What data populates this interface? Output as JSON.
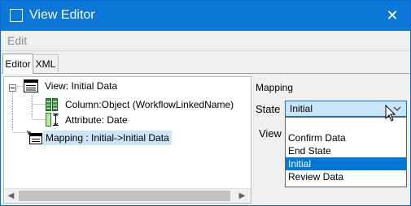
{
  "window": {
    "title": "View Editor",
    "close_glyph": "✕"
  },
  "menu": {
    "edit": "Edit"
  },
  "tabs": [
    {
      "label": "Editor",
      "active": true
    },
    {
      "label": "XML",
      "active": false
    }
  ],
  "tree": {
    "root": {
      "label": "View: Initial Data",
      "icon": "table-icon",
      "expanded": true
    },
    "children": [
      {
        "label": "Column:Object (WorkflowLinkedName)",
        "icon": "column-icon"
      },
      {
        "label": "Attribute: Date",
        "icon": "attribute-icon"
      }
    ],
    "mapping": {
      "label": "Mapping : Initial->Initial Data",
      "icon": "mapping-icon",
      "selected": true
    }
  },
  "mapping_panel": {
    "title": "Mapping",
    "state_label": "State",
    "view_label": "View",
    "state_value": "Initial",
    "options": [
      {
        "label": "",
        "selected": false
      },
      {
        "label": "Confirm Data",
        "selected": false
      },
      {
        "label": "End State",
        "selected": false
      },
      {
        "label": "Initial",
        "selected": true
      },
      {
        "label": "Review Data",
        "selected": false
      }
    ]
  },
  "scrollbar": {
    "left_glyph": "◀",
    "right_glyph": "▶"
  },
  "colors": {
    "titlebar": "#0b78d7",
    "selection": "#0078d7",
    "tree_selection": "#cce4f7"
  }
}
